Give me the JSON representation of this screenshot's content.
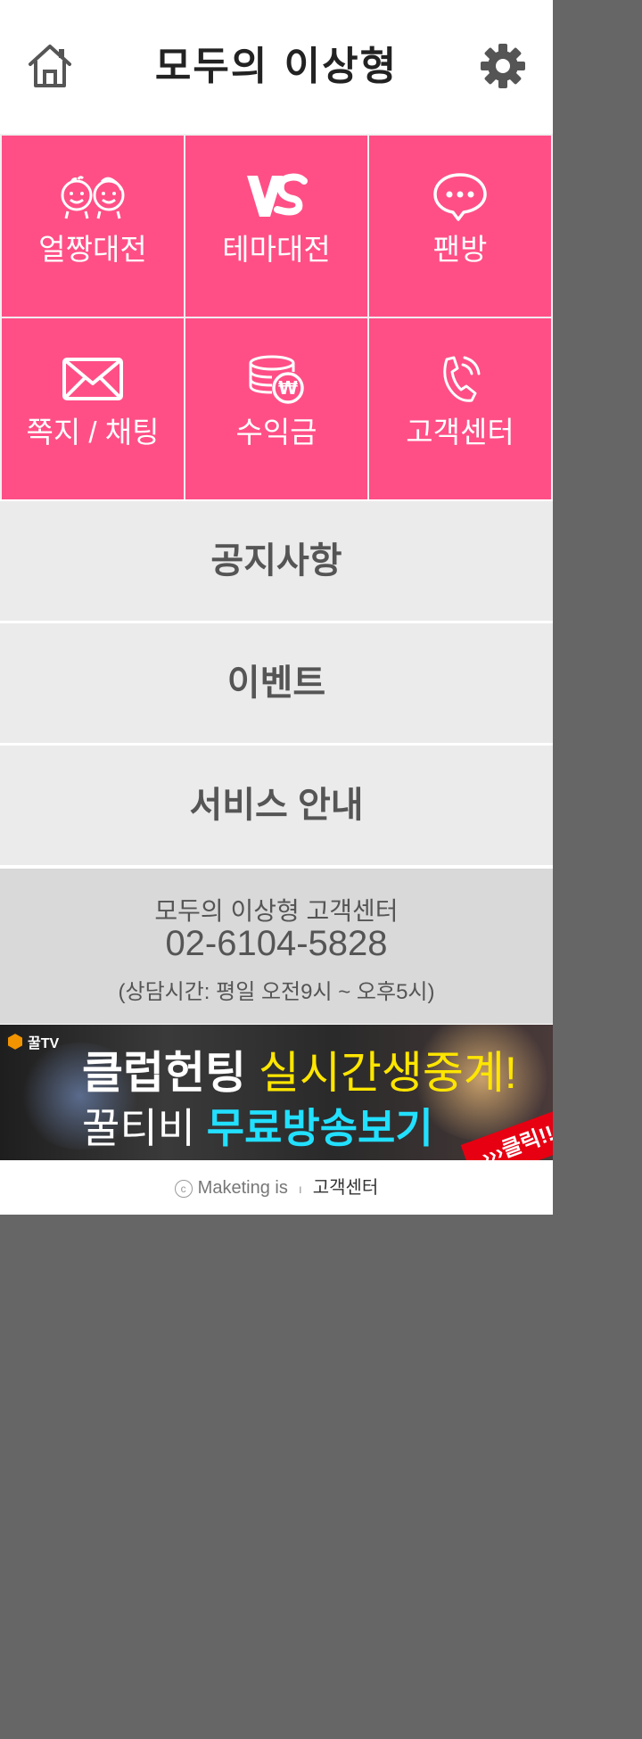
{
  "header": {
    "logo_text": "모두의 이상형",
    "home_icon": "home-icon",
    "settings_icon": "gear-icon"
  },
  "grid": {
    "tiles": [
      {
        "label": "얼짱대전",
        "icon": "faces-icon"
      },
      {
        "label": "테마대전",
        "icon": "vs-icon"
      },
      {
        "label": "팬방",
        "icon": "chat-bubble-icon"
      },
      {
        "label": "쪽지 / 채팅",
        "icon": "envelope-icon"
      },
      {
        "label": "수익금",
        "icon": "coins-won-icon"
      },
      {
        "label": "고객센터",
        "icon": "phone-icon"
      }
    ],
    "tile_color": "#ff4f86"
  },
  "menu": {
    "items": [
      {
        "label": "공지사항"
      },
      {
        "label": "이벤트"
      },
      {
        "label": "서비스 안내"
      }
    ]
  },
  "support": {
    "title": "모두의 이상형 고객센터",
    "phone": "02-6104-5828",
    "hours": "(상담시간: 평일 오전9시 ~ 오후5시)"
  },
  "banner": {
    "brand": "꿀TV",
    "line1_white": "클럽헌팅 ",
    "line1_yellow": "실시간생중계!",
    "line2_white": "꿀티비 ",
    "line2_cyan": "무료방송보기",
    "click_label": "›››클릭!!"
  },
  "footer": {
    "copyright_symbol": "c",
    "copyright": "Maketing is",
    "separator": "ı",
    "link": "고객센터"
  }
}
